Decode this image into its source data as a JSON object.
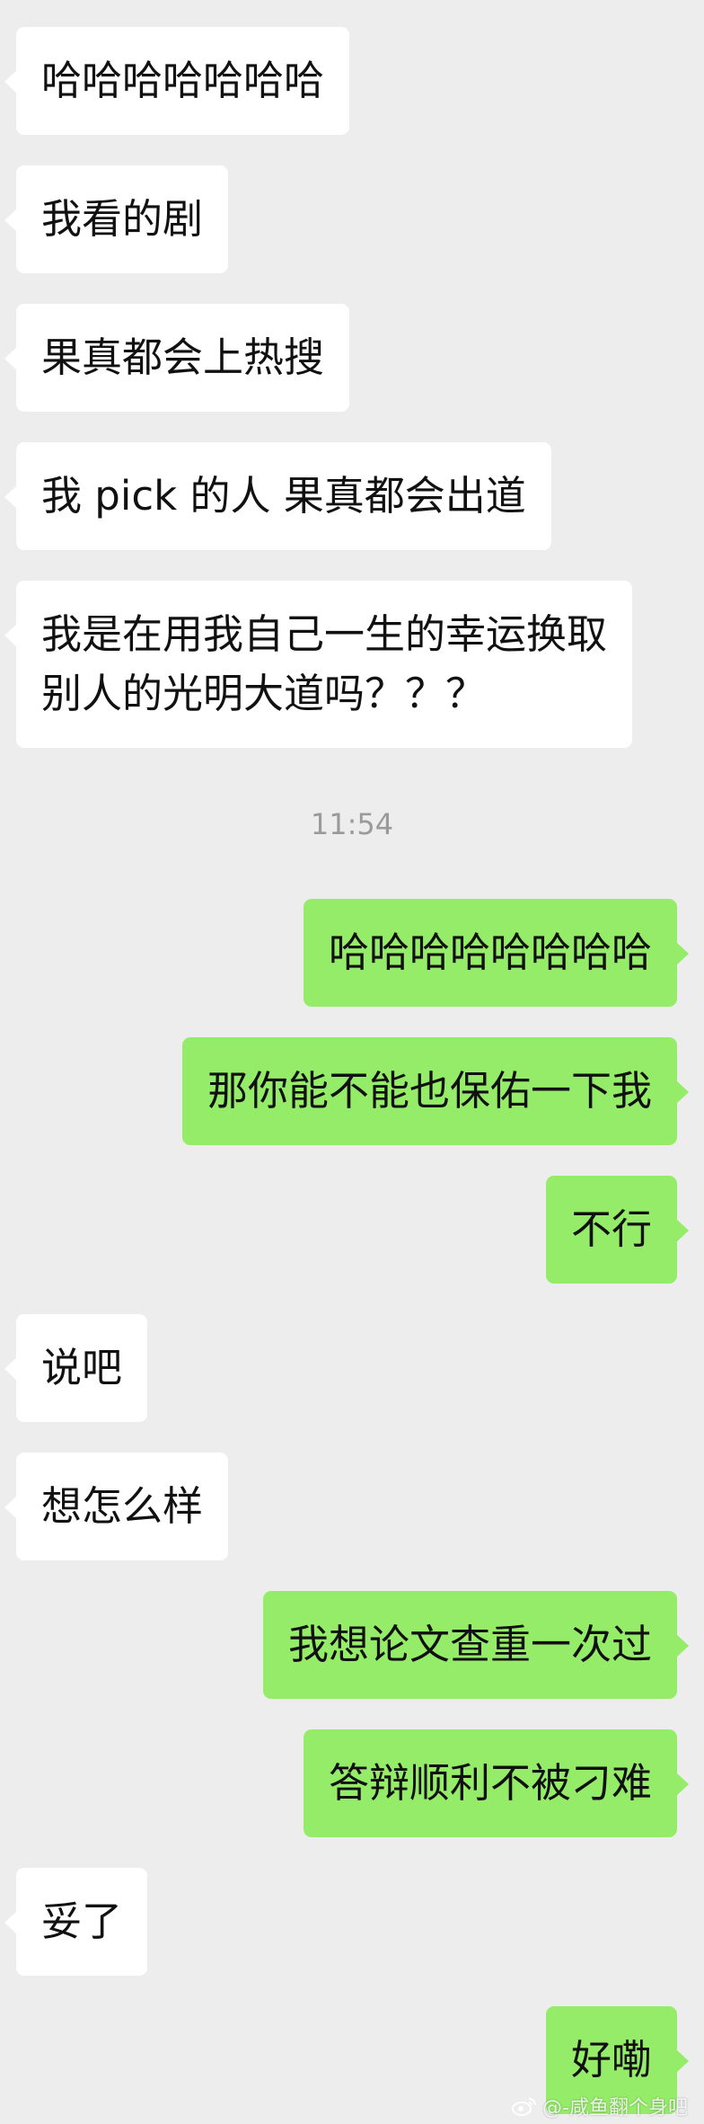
{
  "messages": [
    {
      "side": "in",
      "text": "哈哈哈哈哈哈哈"
    },
    {
      "side": "in",
      "text": "我看的剧"
    },
    {
      "side": "in",
      "text": "果真都会上热搜"
    },
    {
      "side": "in",
      "text": "我 pick 的人 果真都会出道"
    },
    {
      "side": "in",
      "text": "我是在用我自己一生的幸运换取\n别人的光明大道吗？？？"
    },
    {
      "side": "out",
      "text": "哈哈哈哈哈哈哈哈"
    },
    {
      "side": "out",
      "text": "那你能不能也保佑一下我"
    },
    {
      "side": "out",
      "text": "不行"
    },
    {
      "side": "in",
      "text": "说吧"
    },
    {
      "side": "in",
      "text": "想怎么样"
    },
    {
      "side": "out",
      "text": "我想论文查重一次过"
    },
    {
      "side": "out",
      "text": "答辩顺利不被刁难"
    },
    {
      "side": "in",
      "text": "妥了"
    },
    {
      "side": "out",
      "text": "好嘞"
    }
  ],
  "timestamp": "11:54",
  "watermark": "@-咸鱼翻个身吧",
  "colors": {
    "background": "#ededed",
    "incoming_bubble": "#ffffff",
    "outgoing_bubble": "#95ec69"
  }
}
